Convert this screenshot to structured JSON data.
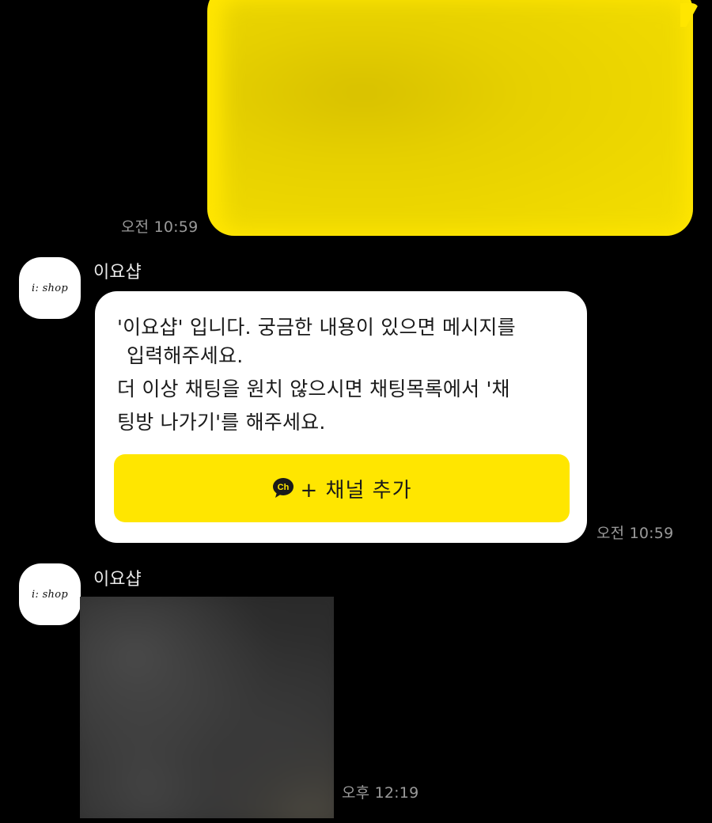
{
  "messages": {
    "outgoing_1": {
      "time": "오전 10:59",
      "color": "#ffe600"
    },
    "incoming_1": {
      "sender": "이요샵",
      "avatar_text": "i: shop",
      "lines": [
        "'이요샵' 입니다.  궁금한 내용이 있으면 메시지를",
        "입력해주세요.",
        "더 이상 채팅을 원치 않으시면 채팅목록에서 '채",
        "팅방 나가기'를 해주세요."
      ],
      "button_icon_text": "Ch",
      "button_label": "+ 채널 추가",
      "time": "오전 10:59"
    },
    "incoming_2": {
      "sender": "이요샵",
      "avatar_text": "i: shop",
      "time": "오후 12:19"
    }
  },
  "colors": {
    "background": "#000000",
    "accent_yellow": "#ffe600",
    "bubble_white": "#ffffff",
    "timestamp": "#9a9a9a"
  },
  "icons": {
    "channel": "chat-bubble-ch-icon"
  }
}
